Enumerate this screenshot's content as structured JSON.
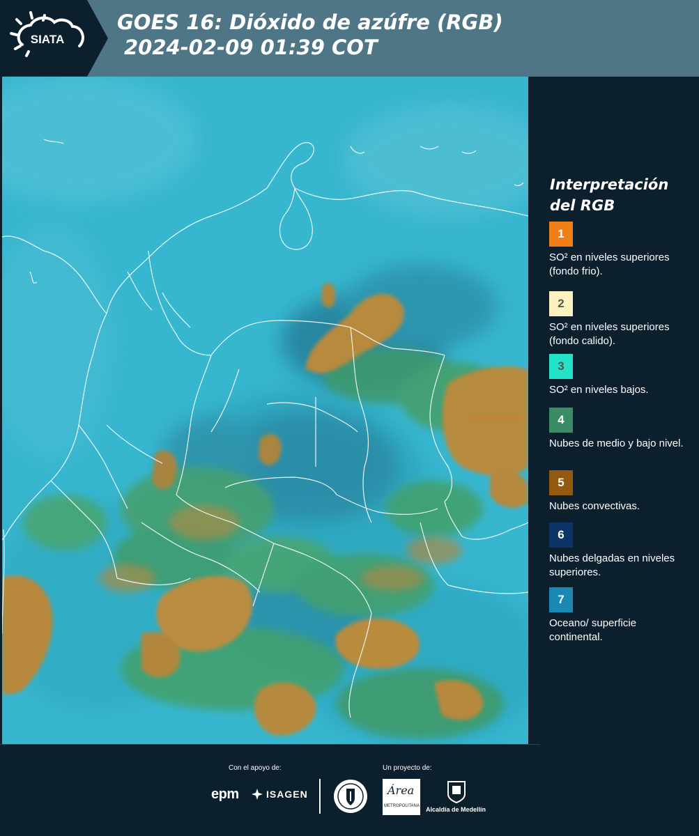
{
  "header": {
    "logo_text": "SIATA",
    "title_line1": "GOES 16: Dióxido de azúfre (RGB)",
    "title_line2": "2024-02-09 01:39 COT"
  },
  "map": {
    "base_color": "#34b4cc",
    "cloud_colors": {
      "convective": "#b6893a",
      "mid_low": "#3f9a6a",
      "thin_high": "#1e6d8a"
    }
  },
  "legend": {
    "title_line1": "Interpretación",
    "title_line2": "del RGB",
    "items": [
      {
        "number": "1",
        "color": "#ef7f16",
        "text": "SO² en niveles superiores (fondo frio)."
      },
      {
        "number": "2",
        "color": "#fbf2c0",
        "text": "SO² en niveles superiores (fondo calido)."
      },
      {
        "number": "3",
        "color": "#24e2c8",
        "text": "SO² en niveles bajos."
      },
      {
        "number": "4",
        "color": "#3b8c66",
        "text": "Nubes de medio y bajo nivel."
      },
      {
        "number": "5",
        "color": "#93590e",
        "text": "Nubes convectivas."
      },
      {
        "number": "6",
        "color": "#0d3468",
        "text": "Nubes delgadas en niveles superiores."
      },
      {
        "number": "7",
        "color": "#1a88b2",
        "text": "Oceano/ superficie continental."
      }
    ]
  },
  "footer": {
    "support_label": "Con el apoyo de:",
    "project_label": "Un proyecto de:",
    "epm": "epm",
    "isagen": "ISAGEN",
    "area_script": "Área",
    "area_caption": "METROPOLITANA Valle de Aburrá",
    "alcaldia": "Alcaldía de Medellín"
  }
}
